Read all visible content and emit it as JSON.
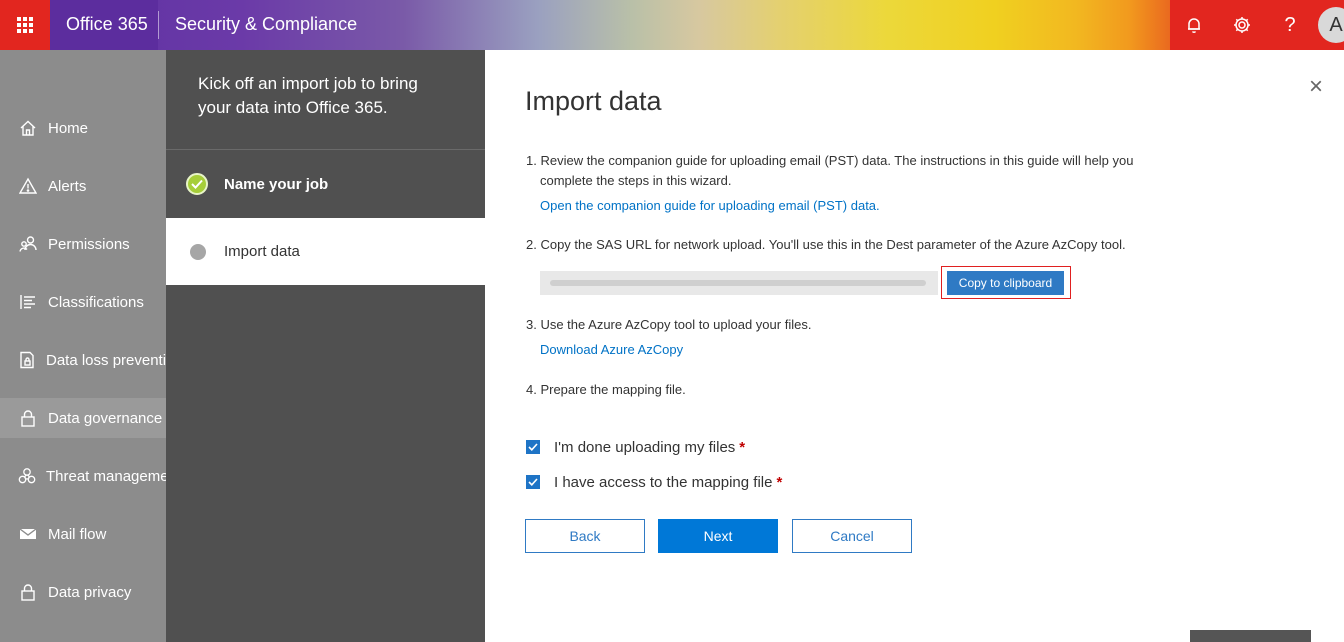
{
  "topbar": {
    "brand": "Office 365",
    "product": "Security & Compliance",
    "avatar_initial": "A",
    "icons": [
      "bell-icon",
      "gear-icon",
      "help-icon"
    ],
    "help_glyph": "?"
  },
  "leftnav": {
    "items": [
      {
        "label": "Home",
        "icon": "home-icon"
      },
      {
        "label": "Alerts",
        "icon": "alert-icon"
      },
      {
        "label": "Permissions",
        "icon": "people-icon"
      },
      {
        "label": "Classifications",
        "icon": "list-icon"
      },
      {
        "label": "Data loss preventi",
        "icon": "lock-doc-icon"
      },
      {
        "label": "Data governance",
        "icon": "lock-icon"
      },
      {
        "label": "Threat manageme",
        "icon": "biohazard-icon"
      },
      {
        "label": "Mail flow",
        "icon": "mail-icon"
      },
      {
        "label": "Data privacy",
        "icon": "lock-icon"
      }
    ]
  },
  "wizard": {
    "heading": "Kick off an import job to bring your data into Office 365.",
    "steps": [
      {
        "label": "Name your job",
        "status": "complete"
      },
      {
        "label": "Import data",
        "status": "current"
      }
    ]
  },
  "main": {
    "title": "Import data",
    "close_glyph": "×",
    "step1_text": "1. Review the companion guide for uploading email (PST) data. The instructions in this guide will help you complete the steps in this wizard.",
    "step1_link": "Open the companion guide for uploading email (PST) data.",
    "step2_text": "2. Copy the SAS URL for network upload. You'll use this in the Dest parameter of the Azure AzCopy tool.",
    "copy_button": "Copy to clipboard",
    "step3_text": "3. Use the Azure AzCopy tool to upload your files.",
    "step3_link": "Download Azure AzCopy",
    "step4_text": "4. Prepare the mapping file.",
    "checkboxes": [
      {
        "label": "I'm done uploading my files",
        "checked": true,
        "required": "*"
      },
      {
        "label": "I have access to the mapping file",
        "checked": true,
        "required": "*"
      }
    ],
    "buttons": {
      "back": "Back",
      "next": "Next",
      "cancel": "Cancel"
    }
  },
  "colors": {
    "accent": "#0078d7",
    "step_complete": "#a6ce39",
    "highlight": "#e02020",
    "required": "#c00000"
  }
}
